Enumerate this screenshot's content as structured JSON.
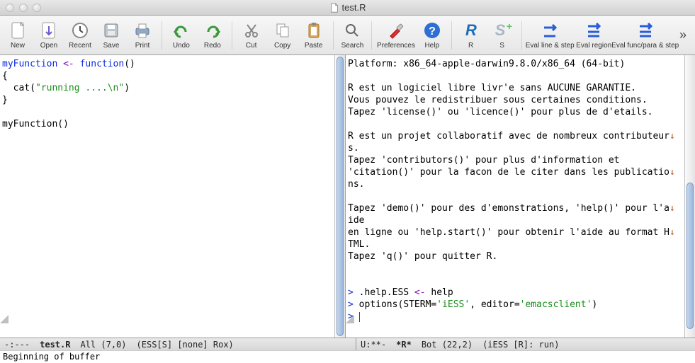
{
  "window": {
    "title": "test.R"
  },
  "toolbar": {
    "new": "New",
    "open": "Open",
    "recent": "Recent",
    "save": "Save",
    "print": "Print",
    "undo": "Undo",
    "redo": "Redo",
    "cut": "Cut",
    "copy": "Copy",
    "paste": "Paste",
    "search": "Search",
    "preferences": "Preferences",
    "help": "Help",
    "r": "R",
    "s": "S",
    "eval_line": "Eval line & step",
    "eval_region": "Eval region",
    "eval_func": "Eval func/para & step"
  },
  "left_editor": {
    "code_html": "<span class=\"k-blue\">myFunction</span> <span class=\"k-purple\">&lt;-</span> <span class=\"k-blue\">function</span>()\n{\n  cat(<span class=\"k-green\">\"running ....\\n\"</span>)\n}\n\nmyFunction()"
  },
  "right_console": {
    "text_html": "Platform: x86_64-apple-darwin9.8.0/x86_64 (64-bit)\n\nR est un logiciel libre livr'e sans AUCUNE GARANTIE.\nVous pouvez le redistribuer sous certaines conditions.\nTapez 'license()' ou 'licence()' pour plus de d'etails.\n\nR est un projet collaboratif avec de nombreux contributeur<span class=\"k-brown\">↓</span>\ns.\nTapez 'contributors()' pour plus d'information et\n'citation()' pour la facon de le citer dans les publicatio<span class=\"k-brown\">↓</span>\nns.\n\nTapez 'demo()' pour des d'emonstrations, 'help()' pour l'a<span class=\"k-brown\">↓</span>\nide\nen ligne ou 'help.start()' pour obtenir l'aide au format H<span class=\"k-brown\">↓</span>\nTML.\nTapez 'q()' pour quitter R.\n\n\n<span class=\"k-blue\">&gt;</span> .help.ESS <span class=\"k-purple\">&lt;-</span> help\n<span class=\"k-blue\">&gt;</span> options(STERM=<span class=\"k-green\">'iESS'</span>, editor=<span class=\"k-green\">'emacsclient'</span>)\n<span class=\"k-blue\">&gt;</span> <span class=\"cursor-blk\"></span>"
  },
  "modeline_left": {
    "state": "-:---",
    "buffer": "test.R",
    "pos": "All (7,0)",
    "mode": "(ESS[S] [none] Rox)"
  },
  "modeline_right": {
    "state": "U:**-",
    "buffer": "*R*",
    "pos": "Bot (22,2)",
    "mode": "(iESS [R]: run)"
  },
  "minibuffer": "Beginning of buffer"
}
